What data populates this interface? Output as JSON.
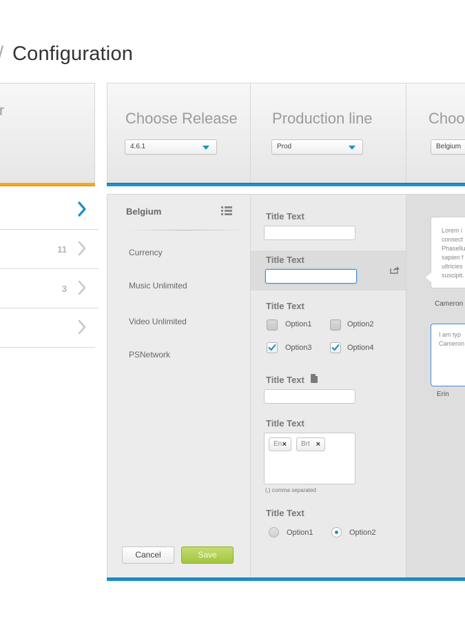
{
  "page": {
    "title_lead": "/",
    "title": "Configuration"
  },
  "left_panel": {
    "header_text": "r",
    "accent_color": "#f1a91f",
    "rows": [
      {
        "count": "",
        "chevron": "active"
      },
      {
        "count": "11",
        "chevron": "inactive"
      },
      {
        "count": "3",
        "chevron": "inactive"
      },
      {
        "count": "",
        "chevron": "inactive"
      }
    ]
  },
  "top_cards": [
    {
      "title": "Choose Release",
      "select_value": "4.6.1"
    },
    {
      "title": "Production line",
      "select_value": "Prod"
    },
    {
      "title": "Choos",
      "select_value": "Belgium"
    }
  ],
  "accent_blue": "#1e90c9",
  "column1": {
    "header": "Belgium",
    "items": [
      "Currency",
      "Music Unlimited",
      "Video Unlimited",
      "PSNetwork"
    ],
    "cancel_label": "Cancel",
    "save_label": "Save"
  },
  "column2": {
    "field1_title": "Title Text",
    "field2_title": "Title Text",
    "field3_title": "Title Text",
    "checkbox_options": [
      {
        "label": "Option1",
        "checked": false
      },
      {
        "label": "Option2",
        "checked": false
      },
      {
        "label": "Option3",
        "checked": true
      },
      {
        "label": "Option4",
        "checked": true
      }
    ],
    "field4_title": "Title Text",
    "field5_title": "Title Text",
    "tags": [
      "En",
      "Brt"
    ],
    "tag_hint": "(,) comma separated",
    "field6_title": "Title Text",
    "radio_options": [
      {
        "label": "Option1",
        "selected": false
      },
      {
        "label": "Option2",
        "selected": true
      }
    ]
  },
  "column3": {
    "bubble1_text": "Lorem i\nconsect\nPhasellu\nsapien f\nultricies\nsuscipit.",
    "bubble1_author": "Cameron",
    "bubble2_text": "I am typ\nCameron",
    "bubble2_author": "Erin"
  }
}
